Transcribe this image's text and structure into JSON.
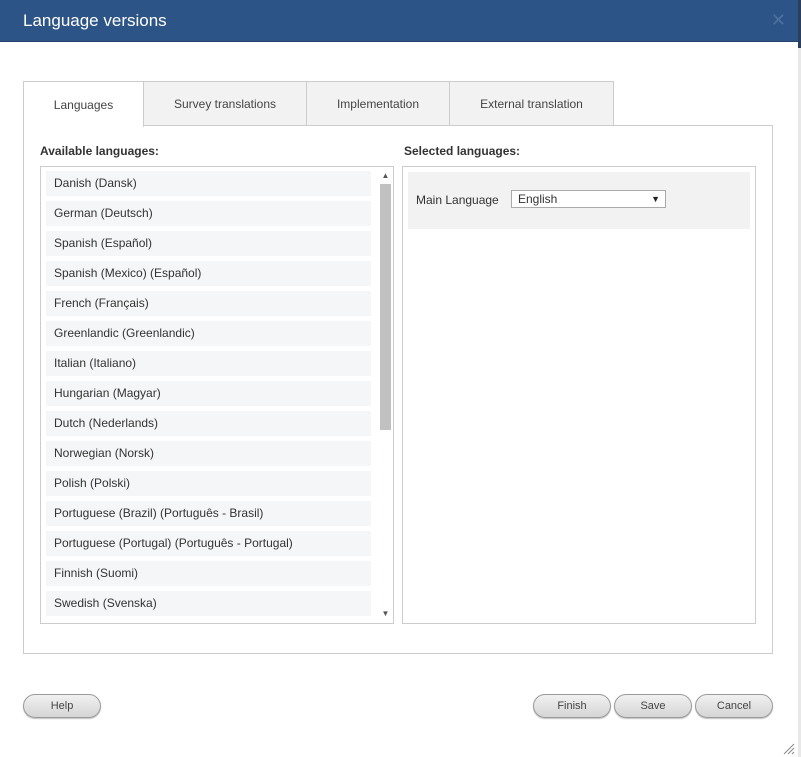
{
  "dialog": {
    "title": "Language versions"
  },
  "tabs": [
    {
      "label": "Languages"
    },
    {
      "label": "Survey translations"
    },
    {
      "label": "Implementation"
    },
    {
      "label": "External translation"
    }
  ],
  "available": {
    "label": "Available languages:",
    "items": [
      "Danish (Dansk)",
      "German (Deutsch)",
      "Spanish (Español)",
      "Spanish (Mexico) (Español)",
      "French (Français)",
      "Greenlandic (Greenlandic)",
      "Italian (Italiano)",
      "Hungarian (Magyar)",
      "Dutch (Nederlands)",
      "Norwegian (Norsk)",
      "Polish (Polski)",
      "Portuguese (Brazil) (Português - Brasil)",
      "Portuguese (Portugal) (Português - Portugal)",
      "Finnish (Suomi)",
      "Swedish (Svenska)"
    ]
  },
  "selected": {
    "label": "Selected languages:",
    "main_language_label": "Main Language",
    "main_language_value": "English"
  },
  "buttons": {
    "help": "Help",
    "finish": "Finish",
    "save": "Save",
    "cancel": "Cancel"
  },
  "icons": {
    "close": "close-icon",
    "dropdown": "chevron-down-icon",
    "scroll_up": "scroll-up-arrow-icon",
    "scroll_down": "scroll-down-arrow-icon",
    "resize": "resize-grip-icon"
  },
  "colors": {
    "titlebar": "#2d5486",
    "title_text": "#ffffff",
    "list_item_bg": "#f5f6f8",
    "border": "#cccccc"
  }
}
